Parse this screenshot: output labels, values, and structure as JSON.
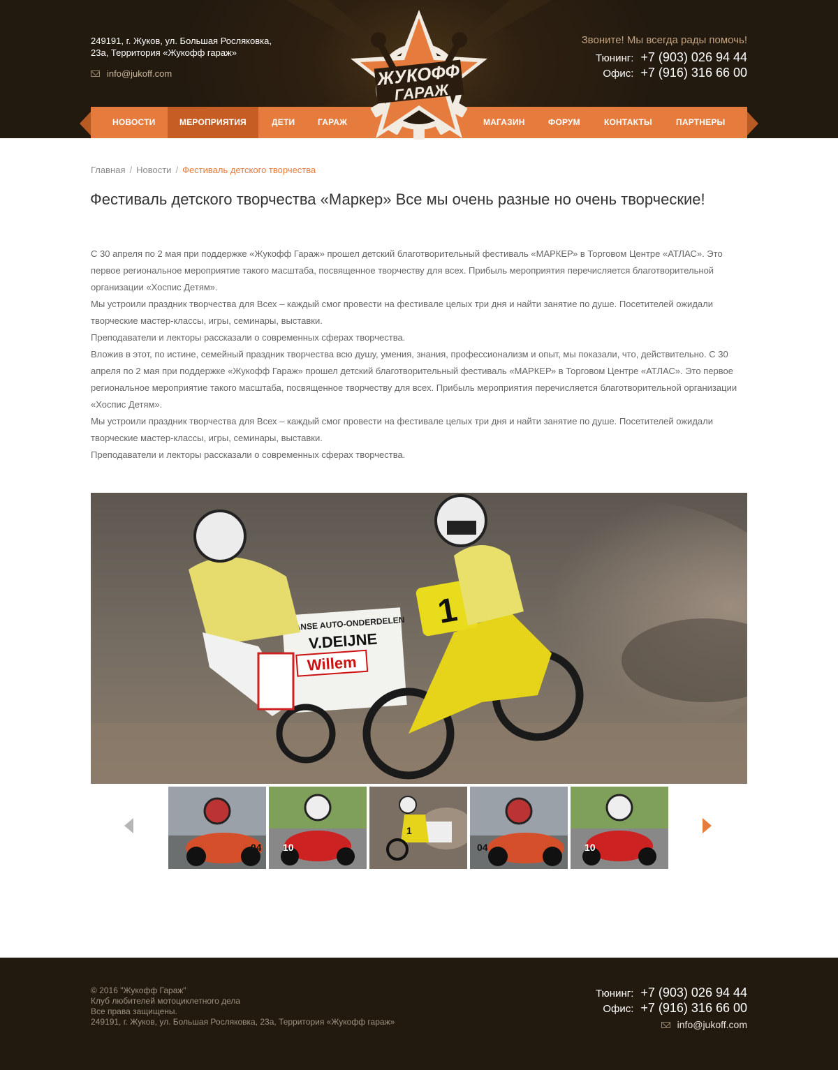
{
  "header": {
    "address_line1": "249191, г. Жуков, ул. Большая Росляковка,",
    "address_line2": "23а, Территория «Жукофф гараж»",
    "email": "info@jukoff.com",
    "call_text": "Звоните! Мы всегда рады помочь!",
    "phones": [
      {
        "label": "Тюнинг:",
        "number": "+7 (903) 026 94 44"
      },
      {
        "label": "Офис:",
        "number": "+7 (916) 316 66 00"
      }
    ]
  },
  "logo": {
    "line1": "ЖУКОФФ",
    "line2": "ГАРАЖ"
  },
  "nav": {
    "items": [
      "Новости",
      "Мероприятия",
      "Дети",
      "Гараж",
      "Магазин",
      "Форум",
      "Контакты",
      "Партнеры"
    ],
    "active": "Мероприятия"
  },
  "breadcrumb": {
    "items": [
      "Главная",
      "Новости"
    ],
    "current": "Фестиваль детского творчества"
  },
  "article": {
    "title": "Фестиваль детского творчества «Маркер» Все мы очень разные но очень творческие!",
    "paragraphs": [
      "С 30 апреля по 2 мая при поддержке «Жукофф Гараж» прошел детский благотворительный фестиваль «МАРКЕР» в Торговом Центре «АТЛАС». Это первое региональное мероприятие такого масштаба, посвященное творчеству для всех. Прибыль мероприятия перечисляется благотворительной организации «Хоспис Детям».",
      "Мы устроили праздник творчества для Всех – каждый смог провести на фестивале целых три дня и найти занятие по душе. Посетителей ожидали творческие мастер-классы, игры, семинары, выставки.",
      "Преподаватели и лекторы рассказали о современных сферах творчества.",
      "Вложив в этот, по истине, семейный праздник творчества всю душу, умения, знания, профессионализм и опыт, мы показали, что, действительно. С 30 апреля по 2 мая при поддержке «Жукофф Гараж» прошел детский благотворительный фестиваль «МАРКЕР» в Торговом Центре «АТЛАС». Это первое региональное мероприятие такого масштаба, посвященное творчеству для всех. Прибыль мероприятия перечисляется благотворительной организации «Хоспис Детям».",
      "Мы устроили праздник творчества для Всех – каждый смог провести на фестивале целых три дня и найти занятие по душе. Посетителей ожидали творческие мастер-классы, игры, семинары, выставки.",
      "Преподаватели и лекторы рассказали о современных сферах творчества."
    ]
  },
  "gallery": {
    "main_sidecar": {
      "board_line1": "JAPANSE AUTO-ONDERDELEN",
      "board_line2": "V.DEIJNE",
      "board_line3": "Willem",
      "bike_number": "1"
    },
    "thumb_numbers": [
      "04",
      "10",
      "1",
      "04",
      "10"
    ]
  },
  "footer": {
    "copyright": "© 2016 \"Жукофф Гараж\"",
    "club": "Клуб любителей мотоциклетного дела",
    "rights": "Все права защищены.",
    "address": "249191, г. Жуков, ул. Большая Росляковка, 23а, Территория «Жукофф гараж»",
    "phones": [
      {
        "label": "Тюнинг:",
        "number": "+7 (903) 026 94 44"
      },
      {
        "label": "Офис:",
        "number": "+7 (916) 316 66 00"
      }
    ],
    "email": "info@jukoff.com"
  },
  "colors": {
    "accent": "#e57b3c",
    "accent_dark": "#c55d25",
    "dark_bg": "#231a0f",
    "text": "#333333",
    "muted": "#666666"
  }
}
